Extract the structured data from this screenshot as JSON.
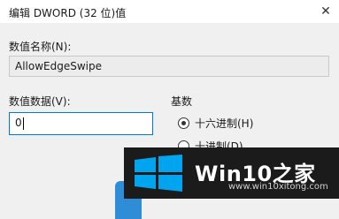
{
  "dialog": {
    "title": "编辑 DWORD (32 位)值",
    "close_glyph": "✕"
  },
  "value_name": {
    "label": "数值名称(N):",
    "value": "AllowEdgeSwipe"
  },
  "value_data": {
    "label": "数值数据(V):",
    "value": "0"
  },
  "base": {
    "label": "基数",
    "options": [
      {
        "label": "十六进制(H)",
        "selected": true
      },
      {
        "label": "十进制(D)",
        "selected": false
      }
    ]
  },
  "watermark": {
    "brand": "Win10之家",
    "url": "www.win10xitong.com",
    "logo_icon": "windows-logo-icon",
    "accent": "#00a4ef"
  }
}
